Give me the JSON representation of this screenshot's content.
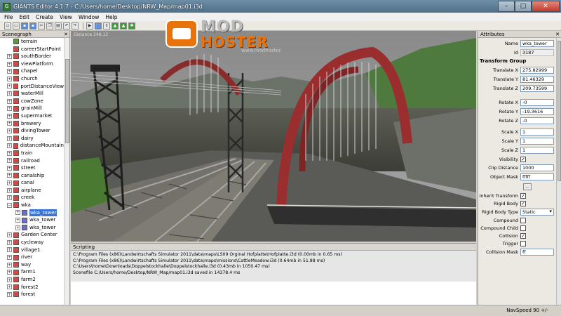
{
  "window": {
    "title": "GIANTS Editor 4.1.7 - C:/Users/home/Desktop/NRW_Map/map01.i3d",
    "minimize": "–",
    "maximize": "□",
    "close": "✕"
  },
  "menu": [
    "File",
    "Edit",
    "Create",
    "View",
    "Window",
    "Help"
  ],
  "logo": {
    "top": "MOD",
    "bottom": "HOSTER",
    "url": "www.modhoster"
  },
  "scenegraph": {
    "title": "Scenegraph",
    "close": "✕",
    "items": [
      {
        "label": "terrain",
        "icon": "terrain",
        "expander": false,
        "level": 0
      },
      {
        "label": "careerStartPoint",
        "icon": "transform-group",
        "expander": false,
        "level": 0
      },
      {
        "label": "southBorder",
        "icon": "transform-group",
        "expander": true,
        "level": 0
      },
      {
        "label": "viewPlatform",
        "icon": "transform-group",
        "expander": true,
        "level": 0
      },
      {
        "label": "chapel",
        "icon": "transform-group",
        "expander": true,
        "level": 0
      },
      {
        "label": "church",
        "icon": "transform-group",
        "expander": true,
        "level": 0
      },
      {
        "label": "portDistanceView",
        "icon": "transform-group",
        "expander": true,
        "level": 0
      },
      {
        "label": "waterMill",
        "icon": "transform-group",
        "expander": true,
        "level": 0
      },
      {
        "label": "cowZone",
        "icon": "transform-group",
        "expander": true,
        "level": 0
      },
      {
        "label": "grainMill",
        "icon": "transform-group",
        "expander": true,
        "level": 0
      },
      {
        "label": "supermarket",
        "icon": "transform-group",
        "expander": true,
        "level": 0
      },
      {
        "label": "brewery",
        "icon": "transform-group",
        "expander": true,
        "level": 0
      },
      {
        "label": "divingTower",
        "icon": "transform-group",
        "expander": true,
        "level": 0
      },
      {
        "label": "dairy",
        "icon": "transform-group",
        "expander": true,
        "level": 0
      },
      {
        "label": "distanceMountain",
        "icon": "transform-group",
        "expander": true,
        "level": 0
      },
      {
        "label": "train",
        "icon": "transform-group",
        "expander": true,
        "level": 0
      },
      {
        "label": "railroad",
        "icon": "transform-group",
        "expander": true,
        "level": 0
      },
      {
        "label": "street",
        "icon": "transform-group",
        "expander": true,
        "level": 0
      },
      {
        "label": "canalship",
        "icon": "transform-group",
        "expander": true,
        "level": 0
      },
      {
        "label": "canal",
        "icon": "transform-group",
        "expander": true,
        "level": 0
      },
      {
        "label": "airplane",
        "icon": "transform-group",
        "expander": true,
        "level": 0
      },
      {
        "label": "creek",
        "icon": "transform-group",
        "expander": true,
        "level": 0
      },
      {
        "label": "wka",
        "icon": "transform-group",
        "expander": true,
        "expanded": true,
        "level": 0
      },
      {
        "label": "wka_tower",
        "icon": "shape",
        "expander": true,
        "level": 1,
        "selected": true
      },
      {
        "label": "wka_tower",
        "icon": "shape",
        "expander": true,
        "level": 1
      },
      {
        "label": "wka_tower",
        "icon": "shape",
        "expander": true,
        "level": 1
      },
      {
        "label": "Garden Center",
        "icon": "transform-group",
        "expander": true,
        "level": 0
      },
      {
        "label": "cycleway",
        "icon": "transform-group",
        "expander": true,
        "level": 0
      },
      {
        "label": "village1",
        "icon": "transform-group",
        "expander": true,
        "level": 0
      },
      {
        "label": "river",
        "icon": "transform-group",
        "expander": true,
        "level": 0
      },
      {
        "label": "way",
        "icon": "transform-group",
        "expander": true,
        "level": 0
      },
      {
        "label": "farm1",
        "icon": "transform-group",
        "expander": true,
        "level": 0
      },
      {
        "label": "farm2",
        "icon": "transform-group",
        "expander": true,
        "level": 0
      },
      {
        "label": "forest2",
        "icon": "transform-group",
        "expander": true,
        "level": 0
      },
      {
        "label": "forest",
        "icon": "transform-group",
        "expander": true,
        "level": 0
      }
    ]
  },
  "viewport": {
    "distance": "Distance 248.12"
  },
  "scripting": {
    "title": "Scripting",
    "lines": [
      "C:\\Program Files (x86)\\Landwirtschafts Simulator 2011\\data\\maps\\LS09 Orginal Hofplatte\\Hofplatte.i3d (0.00mb in 0.65 ms)",
      "C:\\Program Files (x86)\\Landwirtschafts Simulator 2011\\data\\maps\\missions\\CattleMeadow.i3d (0.64mb in 51.88 ms)",
      "C:\\Users\\home\\Downloads\\Doppelstockhalle\\Doppelstockhalle.i3d (0.43mb in 1050.47 ms)",
      "Scenefile C:/Users/home/Desktop/NRW_Map/map01.i3d saved in 14378.4 ms"
    ]
  },
  "attributes": {
    "title": "Attributes",
    "name_label": "Name",
    "name": "wka_tower",
    "id_label": "Id",
    "id": "3187",
    "section": "Transform Group",
    "tx_label": "Translate X",
    "tx": "275.82999",
    "ty_label": "Translate Y",
    "ty": "81.46329",
    "tz_label": "Translate Z",
    "tz": "209.73599",
    "rx_label": "Rotate X",
    "rx": "-0",
    "ry_label": "Rotate Y",
    "ry": "-19.3616",
    "rz_label": "Rotate Z",
    "rz": "-0",
    "sx_label": "Scale X",
    "sx": "1",
    "sy_label": "Scale Y",
    "sy": "1",
    "sz_label": "Scale Z",
    "sz": "1",
    "visibility_label": "Visibility",
    "visibility": "✓",
    "clip_label": "Clip Distance",
    "clip": "1000",
    "mask_label": "Object Mask",
    "mask": "fffff",
    "dots": "...",
    "inherit_label": "Inherit Transform",
    "inherit": "✓",
    "rigid_label": "Rigid Body",
    "rigid": "✓",
    "rigidtype_label": "Rigid Body Type",
    "rigidtype": "Static",
    "compound_label": "Compound",
    "compound": "",
    "compoundchild_label": "Compound Child",
    "compoundchild": "",
    "collision_label": "Collision",
    "collision": "✓",
    "trigger_label": "Trigger",
    "trigger": "",
    "collmask_label": "Collision Mask",
    "collmask": "ff"
  },
  "status": {
    "navspeed": "NavSpeed 90 +/-"
  },
  "colors": {
    "titlebar": "#5a7a94",
    "selection": "#3875d7",
    "bridge_red": "#9a2e2e",
    "logo_orange": "#e8720c"
  }
}
